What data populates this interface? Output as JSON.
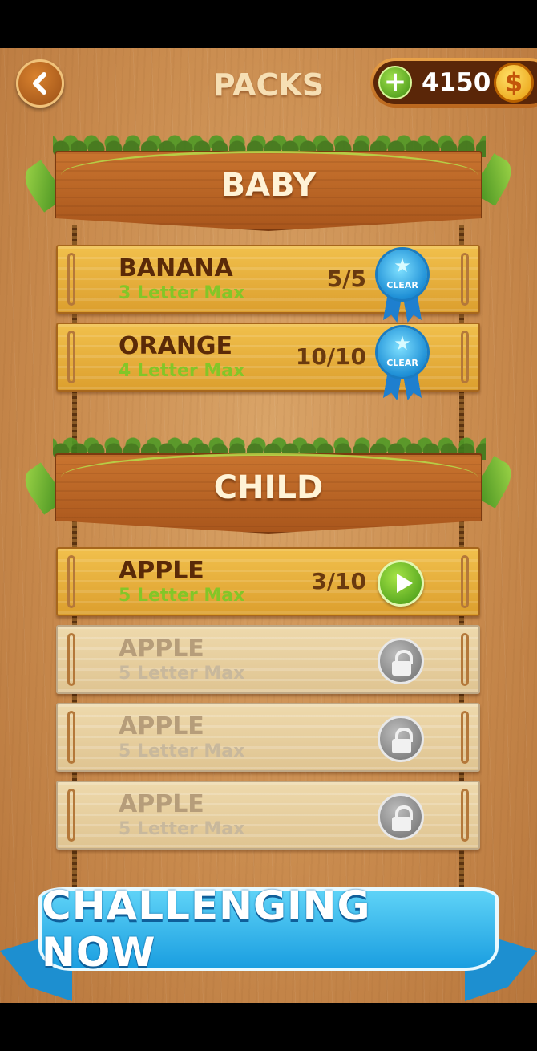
{
  "header": {
    "title": "PACKS",
    "coins": "4150",
    "back_icon": "chevron-left-icon",
    "add_icon": "plus-icon",
    "currency_icon": "dollar-coin-icon"
  },
  "sections": [
    {
      "title": "BABY",
      "packs": [
        {
          "name": "BANANA",
          "subtitle": "3 Letter Max",
          "progress": "5/5",
          "status": "cleared",
          "badge": "CLEAR"
        },
        {
          "name": "ORANGE",
          "subtitle": "4 Letter Max",
          "progress": "10/10",
          "status": "cleared",
          "badge": "CLEAR"
        }
      ]
    },
    {
      "title": "CHILD",
      "packs": [
        {
          "name": "APPLE",
          "subtitle": "5 Letter Max",
          "progress": "3/10",
          "status": "playable"
        },
        {
          "name": "APPLE",
          "subtitle": "5 Letter Max",
          "status": "locked"
        },
        {
          "name": "APPLE",
          "subtitle": "5 Letter Max",
          "status": "locked"
        },
        {
          "name": "APPLE",
          "subtitle": "5 Letter Max",
          "status": "locked"
        }
      ]
    }
  ],
  "bottom_banner": {
    "text": "CHALLENGING NOW"
  },
  "colors": {
    "wood": "#c98b4e",
    "board": "#a9561c",
    "accent_green": "#83c628",
    "banner_blue": "#1a9ee0"
  }
}
